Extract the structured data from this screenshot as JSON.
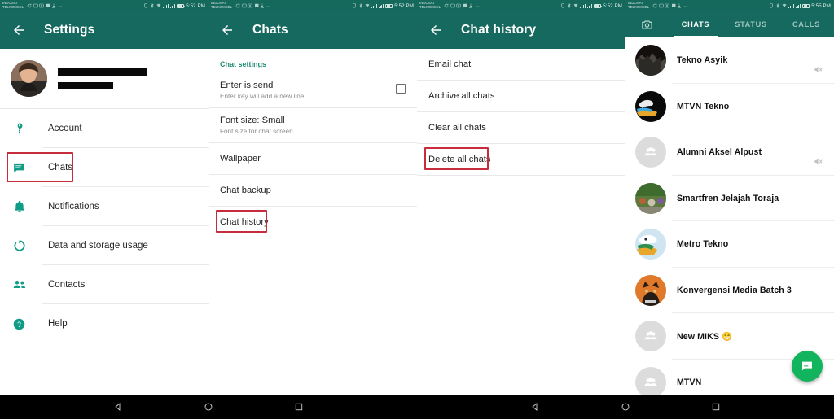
{
  "status_bar": {
    "carrier_line1": "INDOSAT",
    "carrier_line2": "TELKOMSEL",
    "time_1": "5:52 PM",
    "time_2": "5:52 PM",
    "time_3": "5:52 PM",
    "time_4": "5:55 PM",
    "notif_icons": [
      "sync-icon",
      "screenshot-icon",
      "photo-icon",
      "chat-bubble-icon",
      "download-icon",
      "overflow-icon"
    ],
    "right_icons": [
      "location-icon",
      "bluetooth-icon",
      "wifi-icon",
      "signal-1-icon",
      "signal-2-icon",
      "battery-icon"
    ]
  },
  "colors": {
    "header_green": "#16695e",
    "status_green": "#15685c",
    "accent_teal": "#1a8a73",
    "highlight_red": "#c62c3c",
    "fab_green": "#13b45e"
  },
  "panel1": {
    "title": "Settings",
    "back_icon": "back-arrow-icon",
    "profile": {
      "avatar": "profile-photo",
      "name_redacted": true,
      "status_redacted": true
    },
    "items": [
      {
        "label": "Account",
        "icon": "key-icon",
        "highlighted": false
      },
      {
        "label": "Chats",
        "icon": "chat-icon",
        "highlighted": true
      },
      {
        "label": "Notifications",
        "icon": "bell-icon",
        "highlighted": false
      },
      {
        "label": "Data and storage usage",
        "icon": "data-usage-icon",
        "highlighted": false
      },
      {
        "label": "Contacts",
        "icon": "contacts-icon",
        "highlighted": false
      },
      {
        "label": "Help",
        "icon": "help-icon",
        "highlighted": false
      }
    ]
  },
  "panel2": {
    "title": "Chats",
    "back_icon": "back-arrow-icon",
    "section_header": "Chat settings",
    "rows": [
      {
        "title": "Enter is send",
        "subtitle": "Enter key will add a new line",
        "has_checkbox": true,
        "checked": false
      },
      {
        "title": "Font size: Small",
        "subtitle": "Font size for chat screen",
        "has_checkbox": false
      },
      {
        "title": "Wallpaper",
        "subtitle": "",
        "has_checkbox": false
      },
      {
        "title": "Chat backup",
        "subtitle": "",
        "has_checkbox": false
      },
      {
        "title": "Chat history",
        "subtitle": "",
        "has_checkbox": false,
        "highlighted": true
      }
    ]
  },
  "panel3": {
    "title": "Chat history",
    "back_icon": "back-arrow-icon",
    "rows": [
      {
        "label": "Email chat",
        "highlighted": false
      },
      {
        "label": "Archive all chats",
        "highlighted": false
      },
      {
        "label": "Clear all chats",
        "highlighted": false
      },
      {
        "label": "Delete all chats",
        "highlighted": true
      }
    ]
  },
  "panel4": {
    "camera_icon": "camera-icon",
    "tabs": [
      {
        "label": "CHATS",
        "active": true
      },
      {
        "label": "STATUS",
        "active": false
      },
      {
        "label": "CALLS",
        "active": false
      }
    ],
    "chats": [
      {
        "name": "Tekno Asyik",
        "avatar": "photo-dark",
        "muted": true
      },
      {
        "name": "MTVN Tekno",
        "avatar": "logo-eagle-dark",
        "muted": false
      },
      {
        "name": "Alumni Aksel Alpust",
        "avatar": "group-default",
        "muted": true
      },
      {
        "name": "Smartfren Jelajah Toraja",
        "avatar": "photo-crowd",
        "muted": false
      },
      {
        "name": "Metro Tekno",
        "avatar": "logo-eagle-blue",
        "muted": false
      },
      {
        "name": "Konvergensi Media Batch 3",
        "avatar": "photo-cat",
        "muted": false
      },
      {
        "name": "New MIKS 😁",
        "avatar": "group-default",
        "muted": false
      },
      {
        "name": "MTVN",
        "avatar": "group-default",
        "muted": false
      }
    ],
    "fab_icon": "new-chat-icon"
  },
  "navbar": {
    "buttons": [
      "back-triangle-icon",
      "home-circle-icon",
      "recents-square-icon"
    ]
  }
}
